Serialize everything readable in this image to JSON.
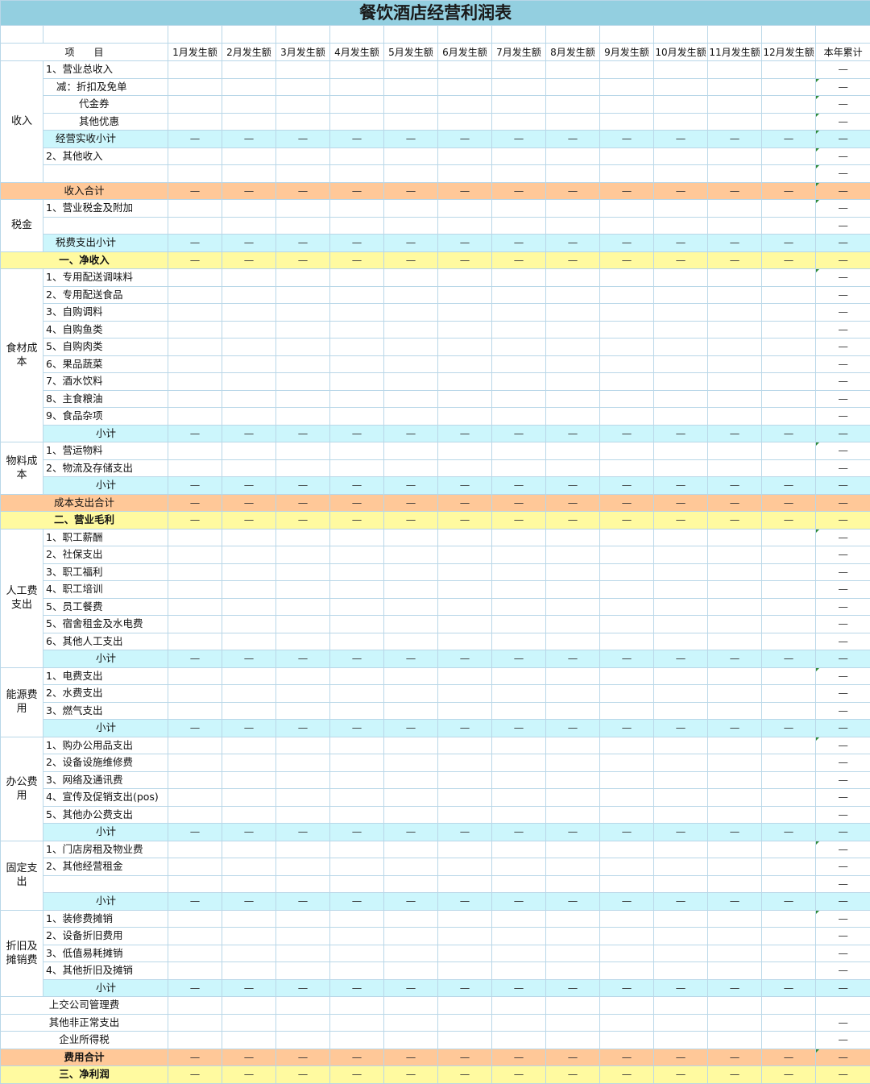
{
  "title": "餐饮酒店经营利润表",
  "header": {
    "item_label": "项　　目",
    "months": [
      "1月发生额",
      "2月发生额",
      "3月发生额",
      "4月发生额",
      "5月发生额",
      "6月发生额",
      "7月发生额",
      "8月发生额",
      "9月发生额",
      "10月发生额",
      "11月发生额",
      "12月发生额"
    ],
    "total_label": "本年累计"
  },
  "dash": "—",
  "categories": [
    "收入",
    "税金",
    "食材成本",
    "物料成本",
    "人工费支出",
    "能源费用",
    "办公费用",
    "固定支出",
    "折旧及摊销费"
  ],
  "rows": [
    {
      "label": "1、营业总收入",
      "cat": 0,
      "span": 7,
      "type": "normal",
      "ind": "",
      "months": false,
      "total": true,
      "acc": false
    },
    {
      "label": "减：折扣及免单",
      "cat": null,
      "type": "normal",
      "ind": "ind1",
      "months": false,
      "total": true,
      "acc": true
    },
    {
      "label": "代金券",
      "cat": null,
      "type": "normal",
      "ind": "ind2",
      "months": false,
      "total": true,
      "acc": true
    },
    {
      "label": "其他优惠",
      "cat": null,
      "type": "normal",
      "ind": "ind2",
      "months": false,
      "total": true,
      "acc": true
    },
    {
      "label": "经营实收小计",
      "cat": null,
      "type": "cyan",
      "ind": "right",
      "months": true,
      "total": true,
      "acc": true
    },
    {
      "label": "2、其他收入",
      "cat": null,
      "type": "normal",
      "ind": "",
      "months": false,
      "total": true,
      "acc": true
    },
    {
      "label": "",
      "cat": null,
      "type": "normal",
      "ind": "",
      "months": false,
      "total": true,
      "acc": true
    },
    {
      "label": "收入合计",
      "cat": "none",
      "type": "orange",
      "ind": "center",
      "months": true,
      "total": true,
      "acc": true
    },
    {
      "label": "1、营业税金及附加",
      "cat": 1,
      "span": 3,
      "type": "normal",
      "ind": "",
      "months": false,
      "total": true,
      "acc": true
    },
    {
      "label": "",
      "cat": null,
      "type": "normal",
      "ind": "",
      "months": false,
      "total": true,
      "acc": false
    },
    {
      "label": "税费支出小计",
      "cat": null,
      "type": "cyan",
      "ind": "right",
      "months": true,
      "total": true,
      "acc": false
    },
    {
      "label": "一、净收入",
      "cat": "none",
      "type": "yellow",
      "ind": "center",
      "bold": true,
      "months": true,
      "total": true,
      "acc": false
    },
    {
      "label": "1、专用配送调味料",
      "cat": 2,
      "span": 10,
      "type": "normal",
      "ind": "",
      "months": false,
      "total": true,
      "acc": true
    },
    {
      "label": "2、专用配送食品",
      "cat": null,
      "type": "normal",
      "ind": "",
      "months": false,
      "total": true,
      "acc": false
    },
    {
      "label": "3、自购调料",
      "cat": null,
      "type": "normal",
      "ind": "",
      "months": false,
      "total": true,
      "acc": false
    },
    {
      "label": "4、自购鱼类",
      "cat": null,
      "type": "normal",
      "ind": "",
      "months": false,
      "total": true,
      "acc": false
    },
    {
      "label": "5、自购肉类",
      "cat": null,
      "type": "normal",
      "ind": "",
      "months": false,
      "total": true,
      "acc": false
    },
    {
      "label": "6、果品蔬菜",
      "cat": null,
      "type": "normal",
      "ind": "",
      "months": false,
      "total": true,
      "acc": false
    },
    {
      "label": "7、酒水饮料",
      "cat": null,
      "type": "normal",
      "ind": "",
      "months": false,
      "total": true,
      "acc": false
    },
    {
      "label": "8、主食粮油",
      "cat": null,
      "type": "normal",
      "ind": "",
      "months": false,
      "total": true,
      "acc": false
    },
    {
      "label": "9、食品杂项",
      "cat": null,
      "type": "normal",
      "ind": "",
      "months": false,
      "total": true,
      "acc": false
    },
    {
      "label": "小计",
      "cat": null,
      "type": "cyan",
      "ind": "right",
      "months": true,
      "total": true,
      "acc": false
    },
    {
      "label": "1、营运物料",
      "cat": 3,
      "span": 3,
      "type": "normal",
      "ind": "",
      "months": false,
      "total": true,
      "acc": true
    },
    {
      "label": "2、物流及存储支出",
      "cat": null,
      "type": "normal",
      "ind": "",
      "months": false,
      "total": true,
      "acc": false
    },
    {
      "label": "小计",
      "cat": null,
      "type": "cyan",
      "ind": "right",
      "months": true,
      "total": true,
      "acc": false
    },
    {
      "label": "成本支出合计",
      "cat": "none",
      "type": "orange",
      "ind": "center",
      "months": true,
      "total": true,
      "acc": false
    },
    {
      "label": "二、营业毛利",
      "cat": "none",
      "type": "yellow",
      "ind": "center",
      "bold": true,
      "months": true,
      "total": true,
      "acc": false
    },
    {
      "label": "1、职工薪酬",
      "cat": 4,
      "span": 8,
      "type": "normal",
      "ind": "",
      "months": false,
      "total": true,
      "acc": true
    },
    {
      "label": "2、社保支出",
      "cat": null,
      "type": "normal",
      "ind": "",
      "months": false,
      "total": true,
      "acc": false
    },
    {
      "label": "3、职工福利",
      "cat": null,
      "type": "normal",
      "ind": "",
      "months": false,
      "total": true,
      "acc": false
    },
    {
      "label": "4、职工培训",
      "cat": null,
      "type": "normal",
      "ind": "",
      "months": false,
      "total": true,
      "acc": false
    },
    {
      "label": "5、员工餐费",
      "cat": null,
      "type": "normal",
      "ind": "",
      "months": false,
      "total": true,
      "acc": false
    },
    {
      "label": "5、宿舍租金及水电费",
      "cat": null,
      "type": "normal",
      "ind": "",
      "months": false,
      "total": true,
      "acc": false
    },
    {
      "label": "6、其他人工支出",
      "cat": null,
      "type": "normal",
      "ind": "",
      "months": false,
      "total": true,
      "acc": false
    },
    {
      "label": "小计",
      "cat": null,
      "type": "cyan",
      "ind": "right",
      "months": true,
      "total": true,
      "acc": false
    },
    {
      "label": "1、电费支出",
      "cat": 5,
      "span": 4,
      "type": "normal",
      "ind": "",
      "months": false,
      "total": true,
      "acc": true
    },
    {
      "label": "2、水费支出",
      "cat": null,
      "type": "normal",
      "ind": "",
      "months": false,
      "total": true,
      "acc": false
    },
    {
      "label": "3、燃气支出",
      "cat": null,
      "type": "normal",
      "ind": "",
      "months": false,
      "total": true,
      "acc": false
    },
    {
      "label": "小计",
      "cat": null,
      "type": "cyan",
      "ind": "right",
      "months": true,
      "total": true,
      "acc": false
    },
    {
      "label": "1、购办公用品支出",
      "cat": 6,
      "span": 6,
      "type": "normal",
      "ind": "",
      "months": false,
      "total": true,
      "acc": true
    },
    {
      "label": "2、设备设施维修费",
      "cat": null,
      "type": "normal",
      "ind": "",
      "months": false,
      "total": true,
      "acc": false
    },
    {
      "label": "3、网络及通讯费",
      "cat": null,
      "type": "normal",
      "ind": "",
      "months": false,
      "total": true,
      "acc": false
    },
    {
      "label": "4、宣传及促销支出(pos)",
      "cat": null,
      "type": "normal",
      "ind": "",
      "months": false,
      "total": true,
      "acc": false
    },
    {
      "label": "5、其他办公费支出",
      "cat": null,
      "type": "normal",
      "ind": "",
      "months": false,
      "total": true,
      "acc": false
    },
    {
      "label": "小计",
      "cat": null,
      "type": "cyan",
      "ind": "right",
      "months": true,
      "total": true,
      "acc": false
    },
    {
      "label": "1、门店房租及物业费",
      "cat": 7,
      "span": 4,
      "type": "normal",
      "ind": "",
      "months": false,
      "total": true,
      "acc": true
    },
    {
      "label": "2、其他经营租金",
      "cat": null,
      "type": "normal",
      "ind": "",
      "months": false,
      "total": true,
      "acc": false
    },
    {
      "label": "",
      "cat": null,
      "type": "normal",
      "ind": "",
      "months": false,
      "total": true,
      "acc": false
    },
    {
      "label": "小计",
      "cat": null,
      "type": "cyan",
      "ind": "right",
      "months": true,
      "total": true,
      "acc": false
    },
    {
      "label": "1、装修费摊销",
      "cat": 8,
      "span": 5,
      "type": "normal",
      "ind": "",
      "months": false,
      "total": true,
      "acc": true
    },
    {
      "label": "2、设备折旧费用",
      "cat": null,
      "type": "normal",
      "ind": "",
      "months": false,
      "total": true,
      "acc": false
    },
    {
      "label": "3、低值易耗摊销",
      "cat": null,
      "type": "normal",
      "ind": "",
      "months": false,
      "total": true,
      "acc": false
    },
    {
      "label": "4、其他折旧及摊销",
      "cat": null,
      "type": "normal",
      "ind": "",
      "months": false,
      "total": true,
      "acc": false
    },
    {
      "label": "小计",
      "cat": null,
      "type": "cyan",
      "ind": "right",
      "months": true,
      "total": true,
      "acc": false
    },
    {
      "label": "上交公司管理费",
      "cat": "none",
      "type": "normal",
      "ind": "center",
      "months": false,
      "total": false,
      "acc": false
    },
    {
      "label": "其他非正常支出",
      "cat": "none",
      "type": "normal",
      "ind": "center",
      "months": false,
      "total": true,
      "acc": false
    },
    {
      "label": "企业所得税",
      "cat": "none",
      "type": "normal",
      "ind": "center",
      "months": false,
      "total": true,
      "acc": false
    },
    {
      "label": "费用合计",
      "cat": "none",
      "type": "orange",
      "ind": "center",
      "bold": true,
      "months": true,
      "total": true,
      "acc": true
    },
    {
      "label": "三、净利润",
      "cat": "none",
      "type": "yellow",
      "ind": "center",
      "bold": true,
      "months": true,
      "total": true,
      "acc": false
    }
  ]
}
